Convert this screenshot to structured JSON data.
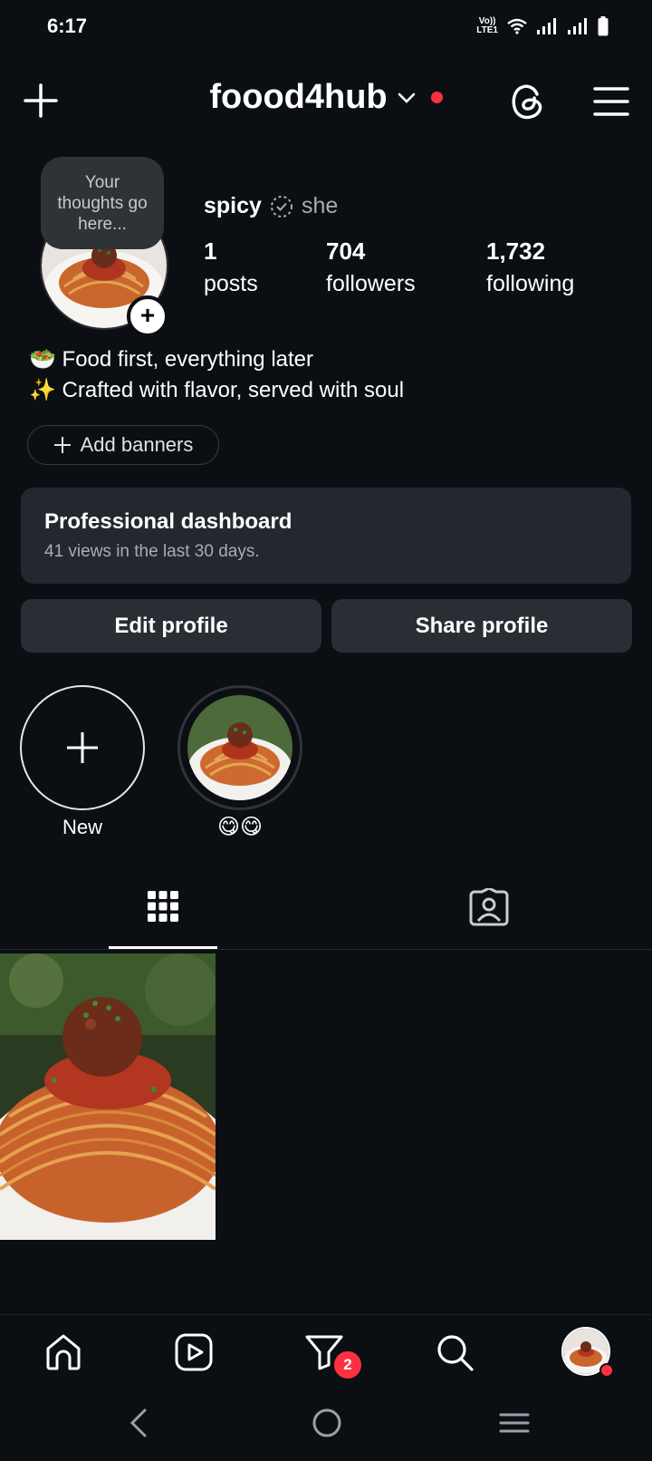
{
  "status": {
    "time": "6:17",
    "volte_top": "Vo))",
    "volte_bottom": "LTE1"
  },
  "header": {
    "username": "foood4hub",
    "icons": [
      "plus-icon",
      "chevron-down-icon",
      "threads-icon",
      "menu-icon"
    ]
  },
  "profile": {
    "note": "Your thoughts go here...",
    "name": "spicy",
    "pronouns": "she",
    "stats": [
      {
        "value": "1",
        "label": "posts"
      },
      {
        "value": "704",
        "label": "followers"
      },
      {
        "value": "1,732",
        "label": "following"
      }
    ],
    "bio": [
      "🥗 Food first, everything later",
      "✨ Crafted with flavor, served with soul"
    ],
    "add_banners": "Add banners"
  },
  "dashboard": {
    "title": "Professional dashboard",
    "subtitle": "41 views in the last 30 days."
  },
  "actions": {
    "edit": "Edit profile",
    "share": "Share profile"
  },
  "highlights": [
    {
      "label": "New"
    },
    {
      "label": "😋😋"
    }
  ],
  "bottom_nav": {
    "notification_count": "2"
  },
  "colors": {
    "background": "#0b0f14",
    "surface": "#24282e",
    "badge_red": "#ff3040"
  }
}
